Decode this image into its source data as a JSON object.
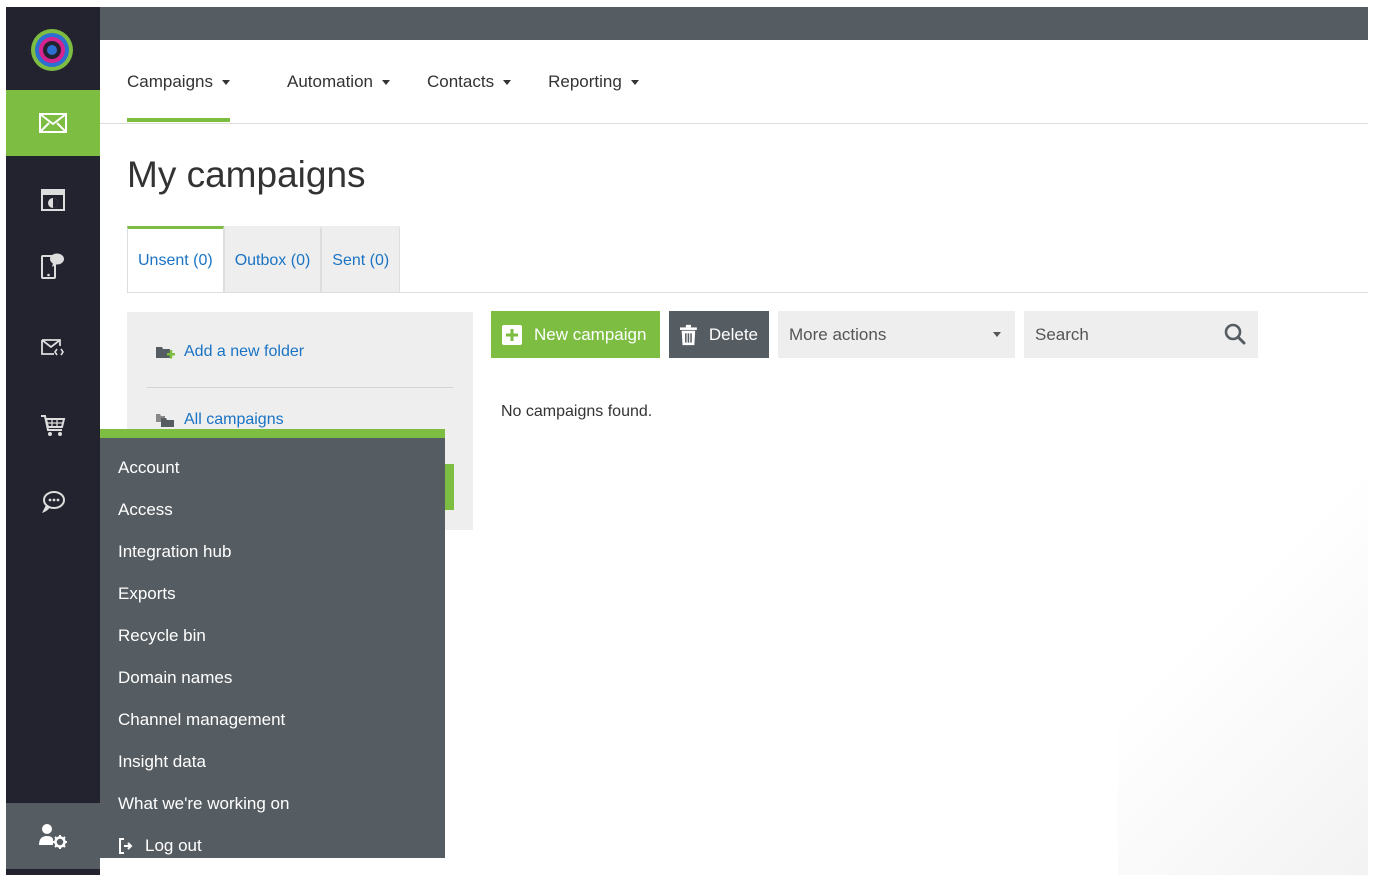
{
  "colors": {
    "accent": "#7cbd42",
    "nav_dark": "#23232f",
    "gray_dark": "#565d62",
    "link": "#1a73c4"
  },
  "leftnav": {
    "logo": "target-logo",
    "items": [
      {
        "icon": "envelope-icon",
        "active": true
      },
      {
        "icon": "landing-page-icon"
      },
      {
        "icon": "mobile-message-icon"
      },
      {
        "icon": "email-code-icon"
      },
      {
        "icon": "shopping-cart-icon"
      },
      {
        "icon": "chat-bubble-icon"
      }
    ],
    "bottom": {
      "icon": "user-settings-icon"
    }
  },
  "mainnav": {
    "items": [
      {
        "label": "Campaigns"
      },
      {
        "label": "Automation"
      },
      {
        "label": "Contacts"
      },
      {
        "label": "Reporting"
      }
    ]
  },
  "page_title": "My campaigns",
  "tabs": [
    {
      "label": "Unsent (0)"
    },
    {
      "label": "Outbox (0)"
    },
    {
      "label": "Sent (0)"
    }
  ],
  "folders": {
    "add_label": "Add a new folder",
    "all_label": "All campaigns"
  },
  "toolbar": {
    "new_label": "New campaign",
    "delete_label": "Delete",
    "more_actions": "More actions",
    "search_placeholder": "Search"
  },
  "empty_message": "No campaigns found.",
  "menu": {
    "items": [
      "Account",
      "Access",
      "Integration hub",
      "Exports",
      "Recycle bin",
      "Domain names",
      "Channel management",
      "Insight data",
      "What we're working on"
    ],
    "logout": "Log out"
  }
}
